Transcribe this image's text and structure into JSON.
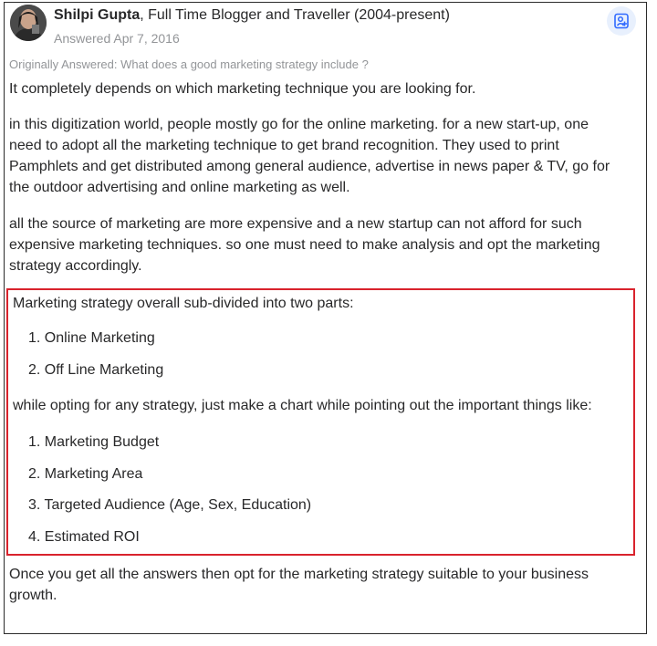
{
  "author": {
    "name": "Shilpi Gupta",
    "credential": ", Full Time Blogger and Traveller (2004-present)",
    "answered": "Answered Apr 7, 2016"
  },
  "originally_answered": "Originally Answered: What does a good marketing strategy include ?",
  "paragraphs": [
    "It completely depends on which marketing technique you are looking for.",
    "in this digitization world, people mostly go for the online marketing. for a new start-up, one need to adopt all the marketing technique to get brand recognition. They used to print Pamphlets and get distributed among general audience, advertise in news paper & TV, go for the outdoor advertising and online marketing as well.",
    "all the source of marketing are more expensive and a new startup can not afford for such expensive marketing techniques. so one must need to make analysis and opt the marketing strategy accordingly."
  ],
  "highlight": {
    "intro": "Marketing strategy overall sub-divided into two parts:",
    "parts": [
      "1. Online Marketing",
      "2. Off Line Marketing"
    ],
    "chart_intro": "while opting for any strategy, just make a chart while pointing out the important things like:",
    "things": [
      "1. Marketing Budget",
      "2. Marketing Area",
      "3. Targeted Audience (Age, Sex, Education)",
      "4. Estimated ROI"
    ]
  },
  "closing": "Once you get all the answers then opt for the marketing strategy suitable to your business growth.",
  "colors": {
    "text": "#282829",
    "muted": "#939598",
    "highlight_border": "#d9232d",
    "follow_bg": "#e8f0fd",
    "follow_icon": "#2e69ff"
  },
  "icons": {
    "follow": "person-add-icon"
  }
}
